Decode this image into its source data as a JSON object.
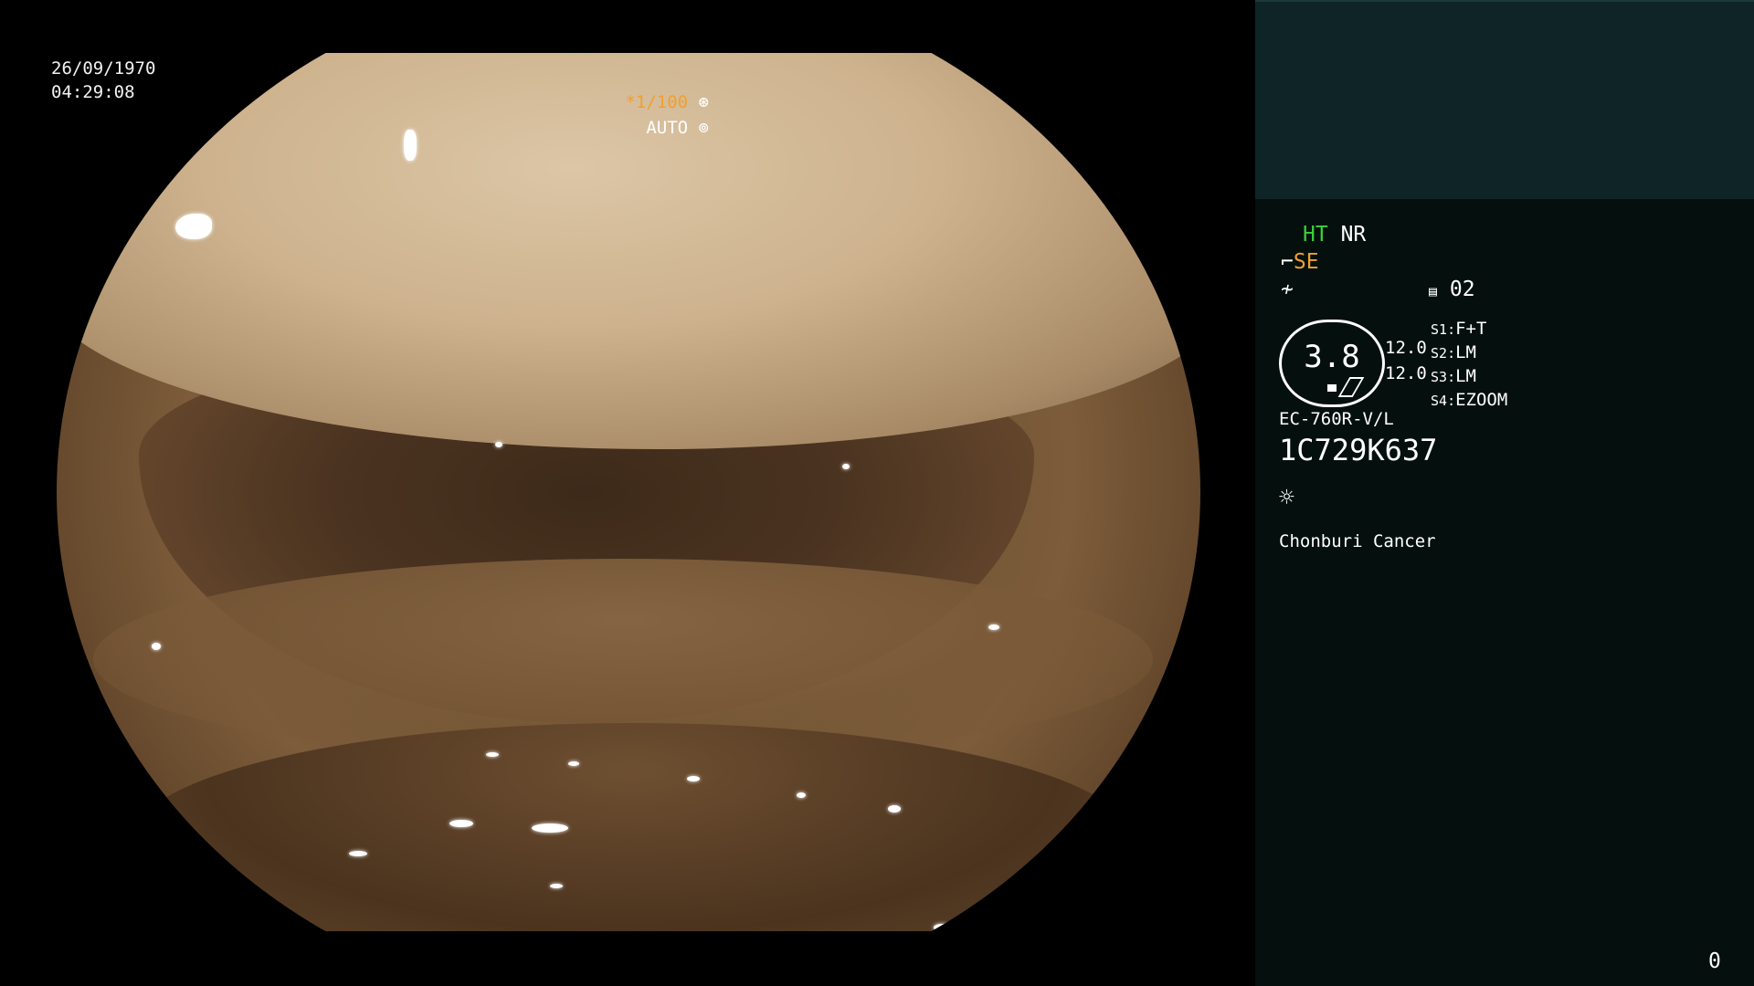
{
  "overlay": {
    "date": "26/09/1970",
    "time": "04:29:08",
    "shutter": "*1/100",
    "mode": "AUTO"
  },
  "panel": {
    "ht": "HT",
    "nr": "NR",
    "se": "SE",
    "page": "02",
    "zoom": "3.8",
    "val1": "12.0",
    "val2": "12.0",
    "switches": [
      {
        "key": "S1",
        "value": "F+T"
      },
      {
        "key": "S2",
        "value": "LM"
      },
      {
        "key": "S3",
        "value": "LM"
      },
      {
        "key": "S4",
        "value": "EZOOM"
      }
    ],
    "scope_model": "EC-760R-V/L",
    "serial": "1C729K637",
    "hospital": "Chonburi Cancer",
    "counter": "0"
  },
  "colors": {
    "green": "#3ad03a",
    "orange": "#f0a030",
    "panel_bg": "#050f0e",
    "panel_top": "#0e2426"
  },
  "icons": [
    "shutter-icon",
    "auto-icon",
    "curve-icon",
    "freeze-icon",
    "memo-icon",
    "light-icon"
  ]
}
